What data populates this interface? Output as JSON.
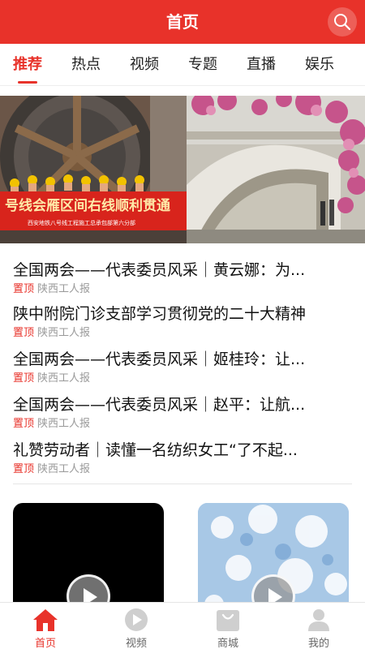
{
  "header": {
    "title": "首页"
  },
  "tabs": [
    {
      "label": "推荐",
      "active": true
    },
    {
      "label": "热点"
    },
    {
      "label": "视频"
    },
    {
      "label": "专题"
    },
    {
      "label": "直播"
    },
    {
      "label": "娱乐"
    }
  ],
  "banner": {
    "left_photo_caption": "号线会雁区间右线顺利贯通",
    "left_photo_subcaption": "西安地铁八号线工程施工总承包部第六分部"
  },
  "news": [
    {
      "title": "全国两会——代表委员风采｜黄云娜：为...",
      "tag": "置顶",
      "source": "陕西工人报"
    },
    {
      "title": "陕中附院门诊支部学习贯彻党的二十大精神",
      "tag": "置顶",
      "source": "陕西工人报"
    },
    {
      "title": "全国两会——代表委员风采｜姬桂玲：让...",
      "tag": "置顶",
      "source": "陕西工人报"
    },
    {
      "title": "全国两会——代表委员风采｜赵平：让航...",
      "tag": "置顶",
      "source": "陕西工人报"
    },
    {
      "title": "礼赞劳动者｜读懂一名纺织女工“了不起...",
      "tag": "置顶",
      "source": "陕西工人报"
    }
  ],
  "tabbar": [
    {
      "label": "首页",
      "icon": "home-icon",
      "active": true
    },
    {
      "label": "视频",
      "icon": "play-icon"
    },
    {
      "label": "商城",
      "icon": "shop-bag-icon"
    },
    {
      "label": "我的",
      "icon": "user-icon"
    }
  ],
  "colors": {
    "brand": "#e8322a",
    "muted": "#999999"
  }
}
